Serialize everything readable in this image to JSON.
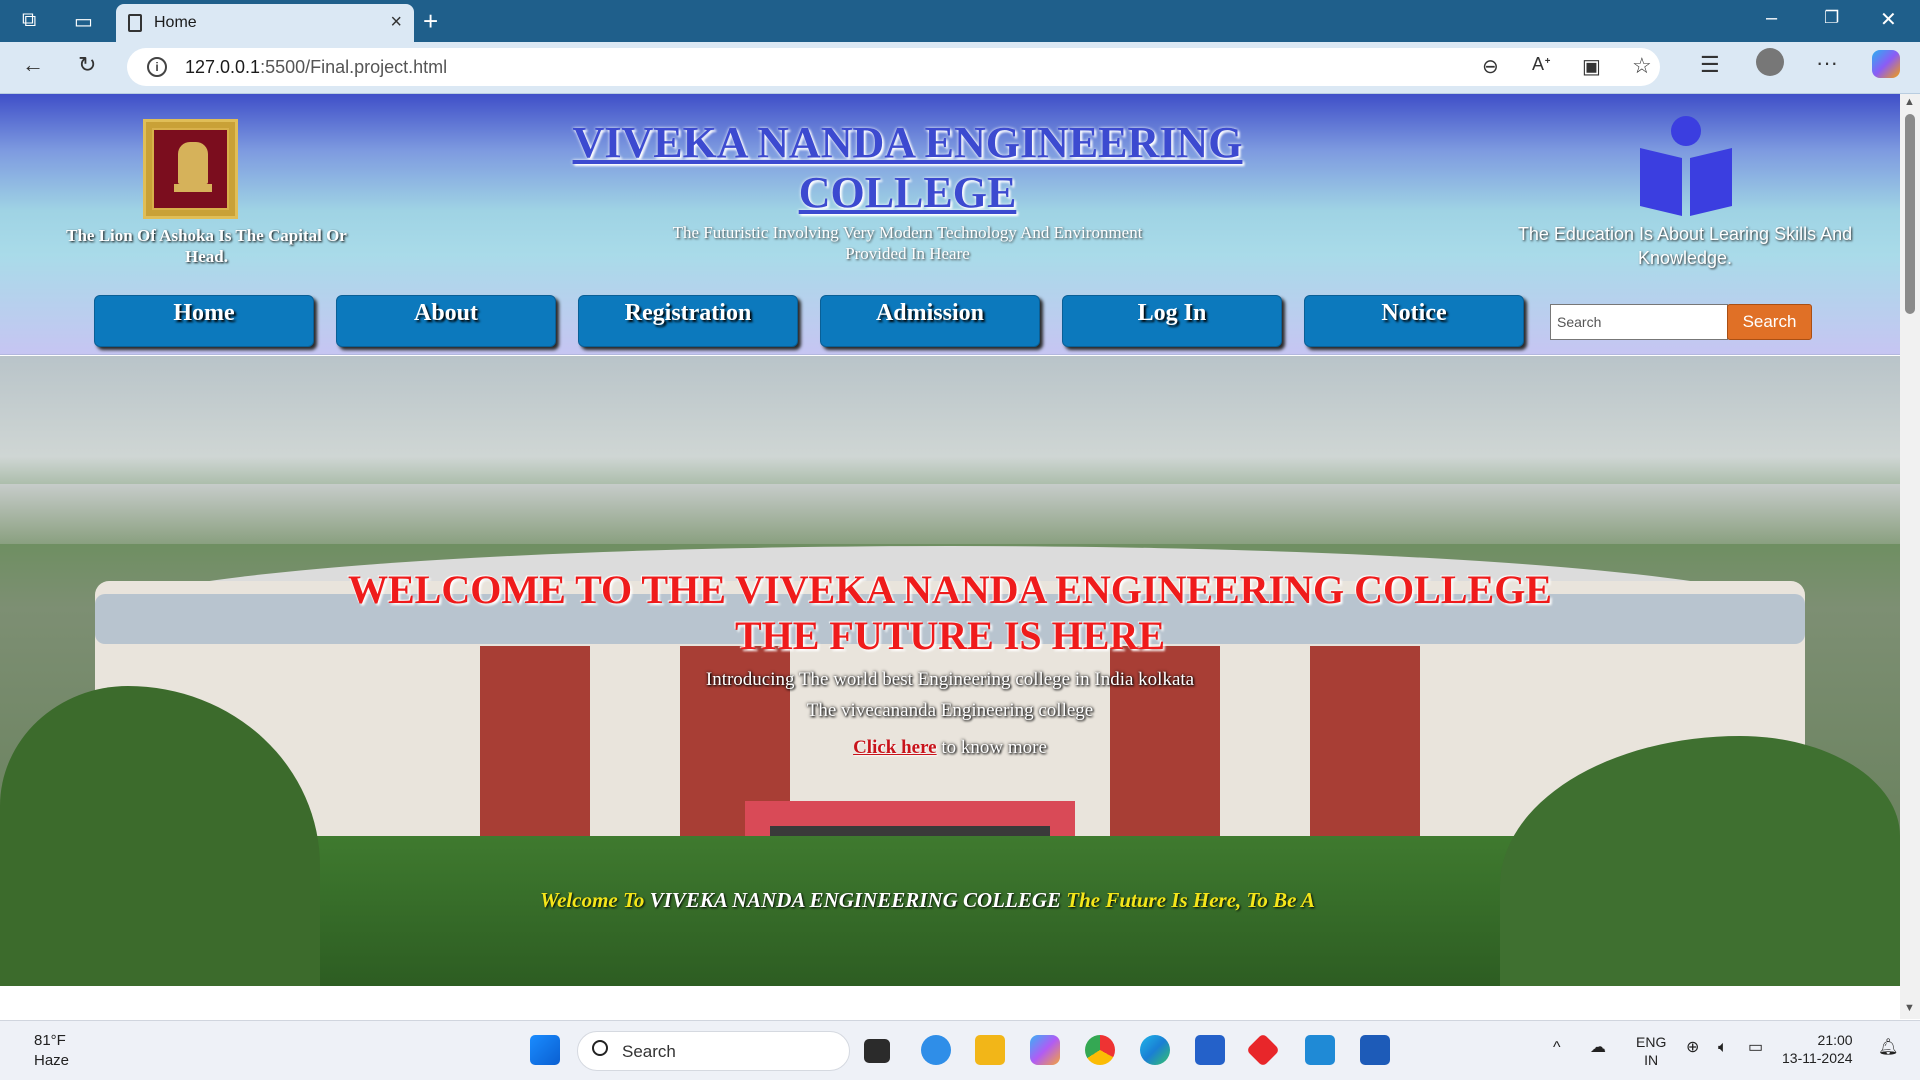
{
  "browser": {
    "tab_title": "Home",
    "url_host": "127.0.0.1",
    "url_rest": ":5500/Final.project.html"
  },
  "header": {
    "emblem_caption": "The Lion Of Ashoka Is The Capital Or Head.",
    "title": "VIVEKA NANDA ENGINEERING COLLEGE",
    "subtitle": "The Futuristic Involving Very Modern Technology And Environment Provided In Heare",
    "right_caption": "The Education Is About Learing Skills And Knowledge."
  },
  "nav": {
    "items": [
      "Home",
      "About",
      "Registration",
      "Admission",
      "Log In",
      "Notice"
    ],
    "search_placeholder": "Search",
    "search_button": "Search"
  },
  "hero": {
    "title_line1": "WELCOME TO THE VIVEKA NANDA ENGINEERING COLLEGE",
    "title_line2": "THE FUTURE IS HERE",
    "intro": "Introducing The world best Engineering college in India kolkata",
    "college_name_line": "The vivecananda Engineering college",
    "link_text": "Click here",
    "link_suffix": " to know more",
    "marquee_part1": "Welcome To ",
    "marquee_part2": " VIVEKA NANDA ENGINEERING COLLEGE ",
    "marquee_part3": " The Future Is Here, To Be A"
  },
  "taskbar": {
    "temperature": "81°F",
    "weather": "Haze",
    "search_label": "Search",
    "lang_line1": "ENG",
    "lang_line2": "IN",
    "time": "21:00",
    "date": "13-11-2024"
  }
}
